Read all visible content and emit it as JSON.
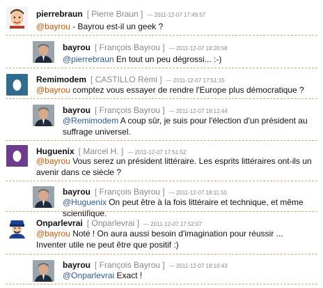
{
  "entries": [
    {
      "username": "pierrebraun",
      "realname": "[ Pierre Braun ]",
      "timestamp": "— 2011-12-07 17:49:57",
      "mention": "@bayrou",
      "text": " - Bayrou est-il un geek ?"
    },
    {
      "username": "bayrou",
      "realname": "[ François Bayrou ]",
      "timestamp": "— 2011-12-07 18:20:58",
      "mention": "@pierrebraun",
      "text": " En tout un peu dégrossi... :-)"
    },
    {
      "username": "Remimodem",
      "realname": "[ CASTILLO Rémi ]",
      "timestamp": "— 2011-12-07 17:51:15",
      "mention": "@bayrou",
      "text": " comptez vous essayer de rendre l'Europe plus démocratique ?"
    },
    {
      "username": "bayrou",
      "realname": "[ François Bayrou ]",
      "timestamp": "— 2011-12-07 18:12:44",
      "mention": "@Remimodem",
      "text": " A coup sûr, je suis pour l'élection d'un président au suffrage universel."
    },
    {
      "username": "Huguenix",
      "realname": "[ Marcel H. ]",
      "timestamp": "— 2011-12-07 17:51:52",
      "mention": "@bayrou",
      "text": " Vous serez un président littéraire. Les esprits littéraires ont-ils un avenir dans ce siècle ?"
    },
    {
      "username": "bayrou",
      "realname": "[ François Bayrou ]",
      "timestamp": "— 2011-12-07 18:11:50",
      "mention": "@Huguenix",
      "text": " On peut être à la fois littéraire et technique, et même scientifique."
    },
    {
      "username": "Onparlevrai",
      "realname": "[ Onparlevrai ]",
      "timestamp": "— 2011-12-07 17:52:07",
      "mention": "@bayrou",
      "text": " Noté ! On aura aussi besoin d'imagination pour réussir ... Inventer utile ne peut être que positif :)"
    },
    {
      "username": "bayrou",
      "realname": "[ François Bayrou ]",
      "timestamp": "— 2011-12-07 18:10:43",
      "mention": "@Onparlevrai",
      "text": " Exact !"
    }
  ]
}
